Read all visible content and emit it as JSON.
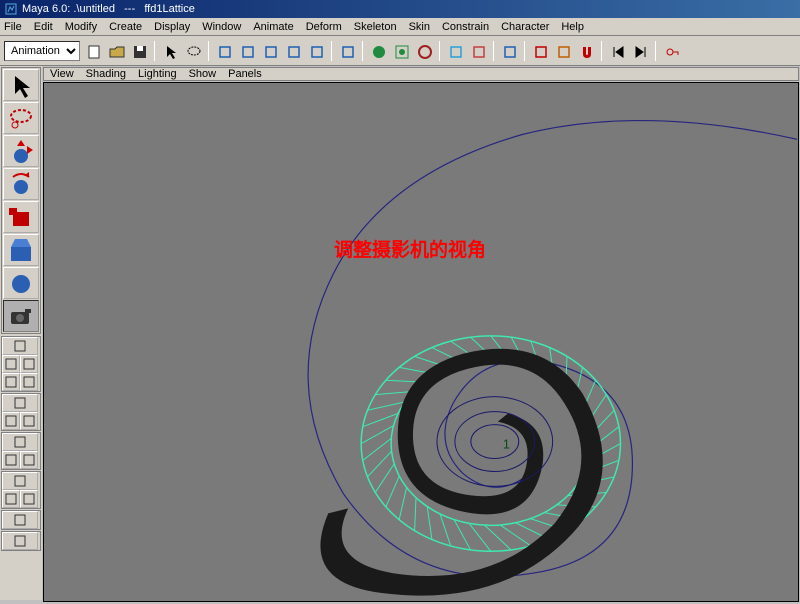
{
  "titlebar": {
    "app_name": "Maya 6.0",
    "file": ".\\untitled",
    "sep": "---",
    "context": "ffd1Lattice"
  },
  "menubar": {
    "items": [
      "File",
      "Edit",
      "Modify",
      "Create",
      "Display",
      "Window",
      "Animate",
      "Deform",
      "Skeleton",
      "Skin",
      "Constrain",
      "Character",
      "Help"
    ]
  },
  "toolbar": {
    "mode_options": [
      "Animation"
    ],
    "mode_selected": "Animation",
    "buttons": [
      {
        "name": "new-scene-icon",
        "color": "#333"
      },
      {
        "name": "open-icon",
        "color": "#c9a84a"
      },
      {
        "name": "save-icon",
        "color": "#333"
      },
      {
        "name": "sep"
      },
      {
        "name": "select-arrow-icon",
        "color": "#000"
      },
      {
        "name": "lasso-icon",
        "color": "#000"
      },
      {
        "name": "sep"
      },
      {
        "name": "snap-grid-icon",
        "color": "#1e5fb4"
      },
      {
        "name": "snap-curve-icon",
        "color": "#1e5fb4"
      },
      {
        "name": "snap-point-icon",
        "color": "#1e5fb4"
      },
      {
        "name": "snap-plane-icon",
        "color": "#1e5fb4"
      },
      {
        "name": "snap-live-icon",
        "color": "#1e5fb4"
      },
      {
        "name": "sep"
      },
      {
        "name": "history-toggle-icon",
        "color": "#1e5fb4"
      },
      {
        "name": "sep"
      },
      {
        "name": "render-icon",
        "color": "#1e8b3e"
      },
      {
        "name": "ipr-icon",
        "color": "#1e8b3e"
      },
      {
        "name": "render-globals-icon",
        "color": "#a02020"
      },
      {
        "name": "sep"
      },
      {
        "name": "field-icon",
        "color": "#2a9fd6"
      },
      {
        "name": "particle-icon",
        "color": "#c04040"
      },
      {
        "name": "sep"
      },
      {
        "name": "hypergraph-icon",
        "color": "#1e5fb4"
      },
      {
        "name": "sep"
      },
      {
        "name": "input-conn-icon",
        "color": "#c00000"
      },
      {
        "name": "output-conn-icon",
        "color": "#c06000"
      },
      {
        "name": "magnet-icon",
        "color": "#c00000"
      },
      {
        "name": "sep"
      },
      {
        "name": "go-start-icon",
        "color": "#000"
      },
      {
        "name": "go-end-icon",
        "color": "#000"
      },
      {
        "name": "sep"
      },
      {
        "name": "key-icon",
        "color": "#c00000"
      }
    ]
  },
  "sidebar": {
    "tools": [
      {
        "name": "select-tool",
        "icon": "arrow",
        "color": "#000"
      },
      {
        "name": "lasso-tool",
        "icon": "lasso",
        "color": "#c00000"
      },
      {
        "name": "move-tool",
        "icon": "move",
        "color": "#1e5fb4"
      },
      {
        "name": "rotate-tool",
        "icon": "rotate",
        "color": "#1e5fb4"
      },
      {
        "name": "scale-tool",
        "icon": "scale",
        "color": "#c00000"
      },
      {
        "name": "manip-tool",
        "icon": "manip",
        "color": "#1e5fb4"
      },
      {
        "name": "soft-mod-tool",
        "icon": "circle",
        "color": "#1e5fb4"
      },
      {
        "name": "last-tool",
        "icon": "camera",
        "color": "#333",
        "active": true
      }
    ],
    "shelf_groups": [
      {
        "rows": [
          [
            "single-persp"
          ],
          [
            "four-view-tl",
            "four-view-tr"
          ],
          [
            "four-view-bl",
            "four-view-br"
          ]
        ]
      },
      {
        "rows": [
          [
            "outliner"
          ],
          [
            "two-side-l",
            "two-side-r"
          ]
        ]
      },
      {
        "rows": [
          [
            "persp-out"
          ],
          [
            "graph-l",
            "graph-r"
          ]
        ]
      },
      {
        "rows": [
          [
            "hyper"
          ],
          [
            "dope-l",
            "dope-r"
          ]
        ]
      },
      {
        "rows": [
          [
            "script"
          ]
        ]
      },
      {
        "rows": [
          [
            "down-arrow"
          ]
        ]
      }
    ]
  },
  "viewmenu": {
    "items": [
      "View",
      "Shading",
      "Lighting",
      "Show",
      "Panels"
    ]
  },
  "viewport": {
    "annotation": "调整摄影机的视角",
    "center_label": "1",
    "colors": {
      "bg": "#7a7a7a",
      "curve_outer": "#26267f",
      "curve_inner": "#1a1a6a",
      "lattice": "#3fe8b0",
      "shape_fill": "#1a1a1a",
      "label": "#0a4a1a"
    }
  }
}
